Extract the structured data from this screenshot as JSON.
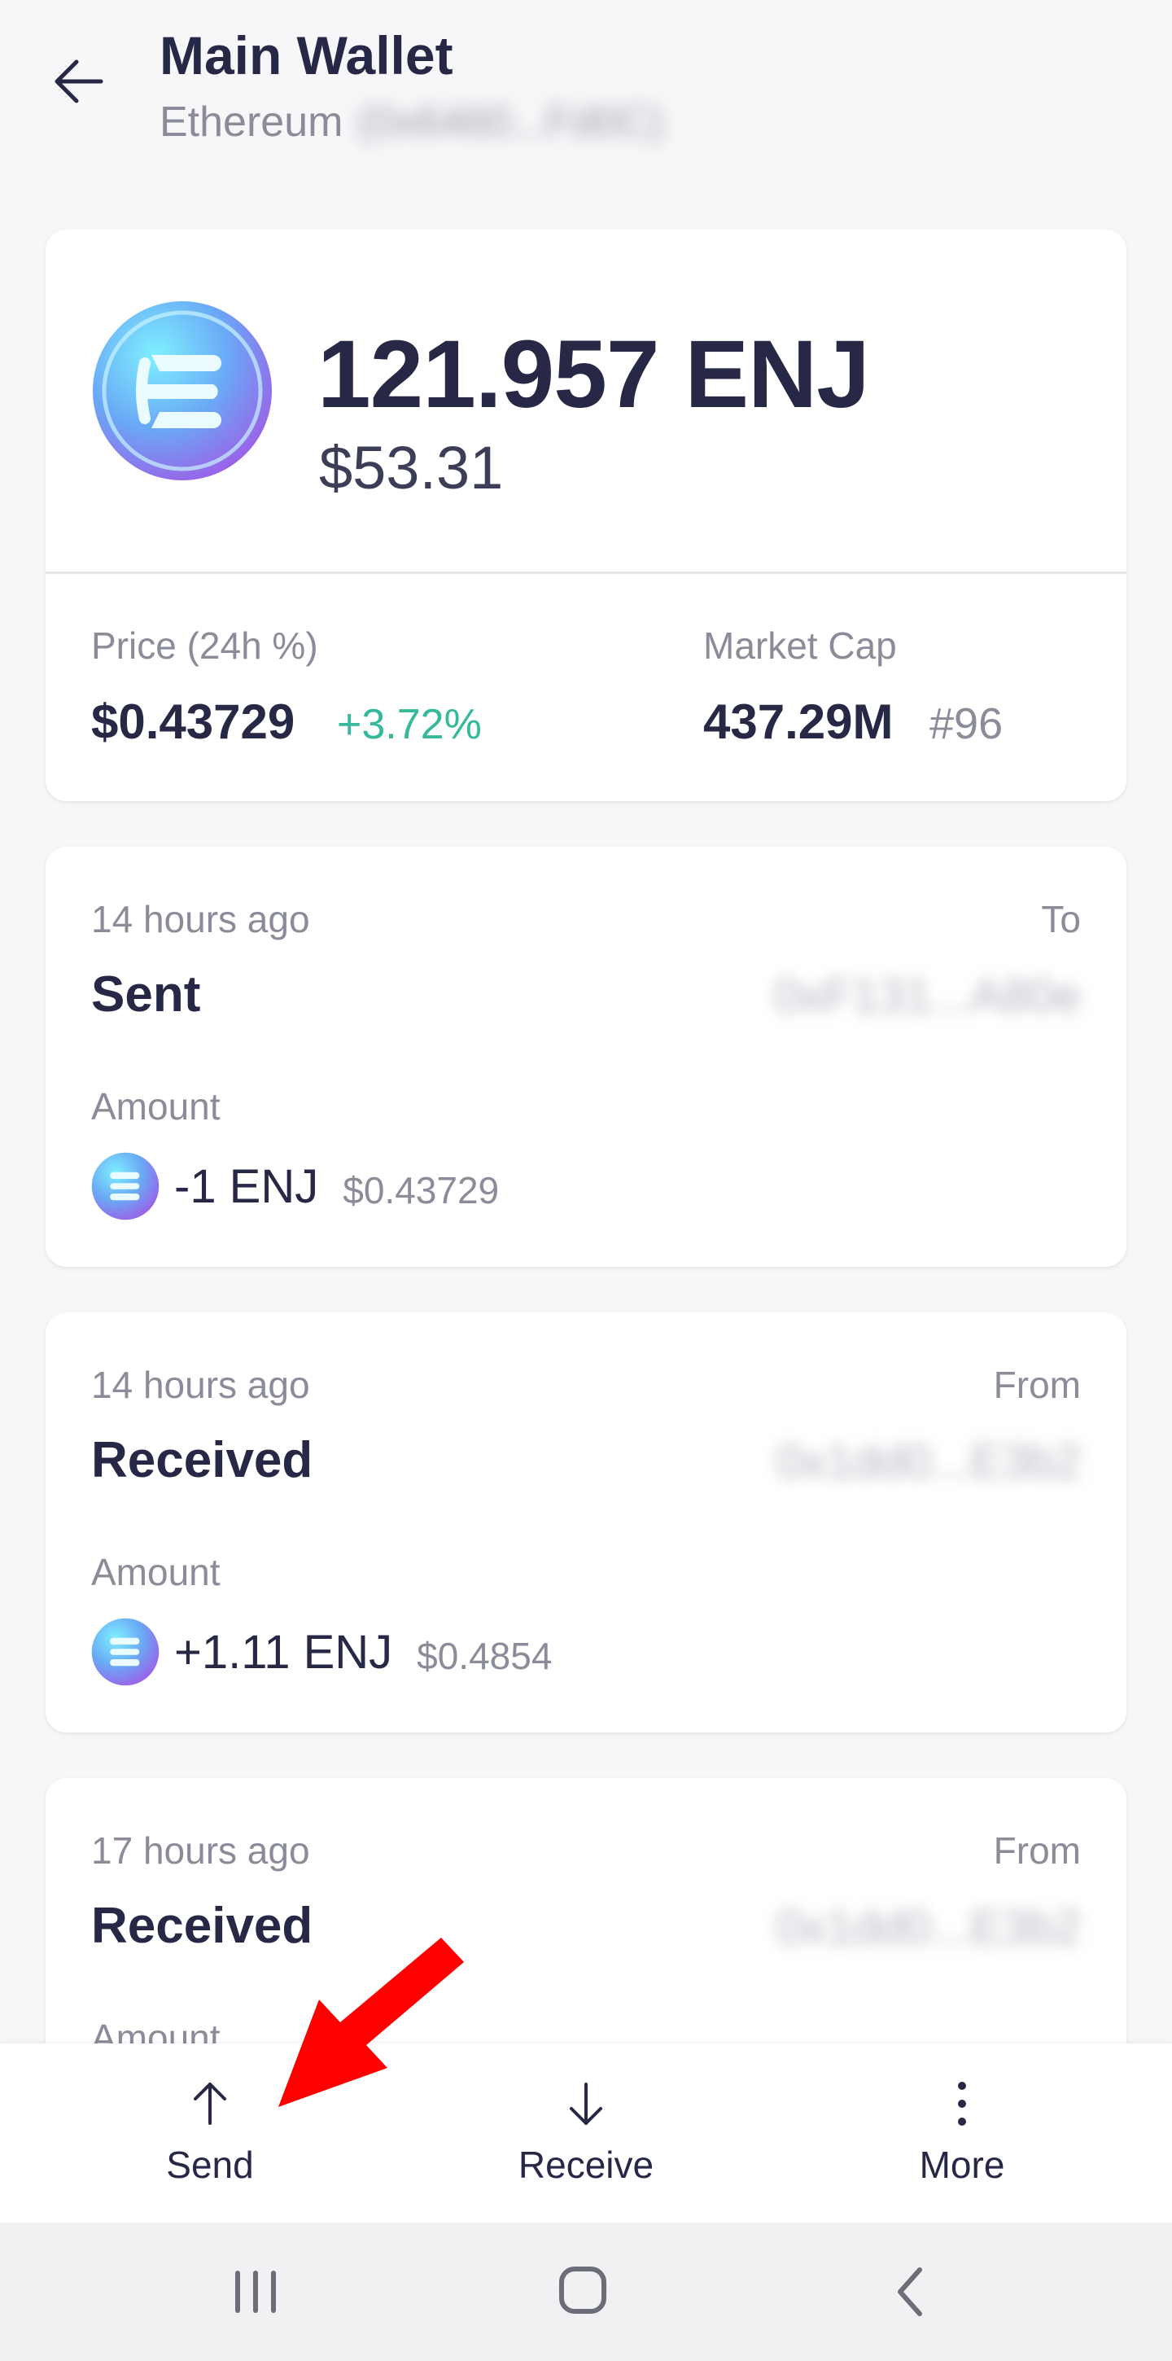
{
  "header": {
    "title": "Main Wallet",
    "network": "Ethereum",
    "address_masked": "(0x6460...Fd0C)"
  },
  "balance": {
    "amount": "121.957 ENJ",
    "fiat": "$53.31",
    "price_label": "Price (24h %)",
    "price_value": "$0.43729",
    "price_change": "+3.72%",
    "mcap_label": "Market Cap",
    "mcap_value": "437.29M",
    "mcap_rank": "#96"
  },
  "transactions": [
    {
      "time": "14 hours ago",
      "direction_label": "To",
      "type": "Sent",
      "address": "0xF131...A80e",
      "amount_label": "Amount",
      "amount": "-1 ENJ",
      "fiat": "$0.43729"
    },
    {
      "time": "14 hours ago",
      "direction_label": "From",
      "type": "Received",
      "address": "0x1dd0...E3b2",
      "amount_label": "Amount",
      "amount": "+1.11 ENJ",
      "fiat": "$0.4854"
    },
    {
      "time": "17 hours ago",
      "direction_label": "From",
      "type": "Received",
      "address": "0x1dd0...E3b2",
      "amount_label": "Amount",
      "amount": "",
      "fiat": ""
    }
  ],
  "actions": {
    "send": "Send",
    "receive": "Receive",
    "more": "More"
  },
  "colors": {
    "text_primary": "#262846",
    "text_secondary": "#8a8c99",
    "positive": "#35b99a",
    "annotation": "#ff0000"
  },
  "icons": {
    "back": "arrow-left-icon",
    "token": "enjin-logo-icon",
    "send": "arrow-up-icon",
    "receive": "arrow-down-icon",
    "more": "vertical-dots-icon"
  }
}
